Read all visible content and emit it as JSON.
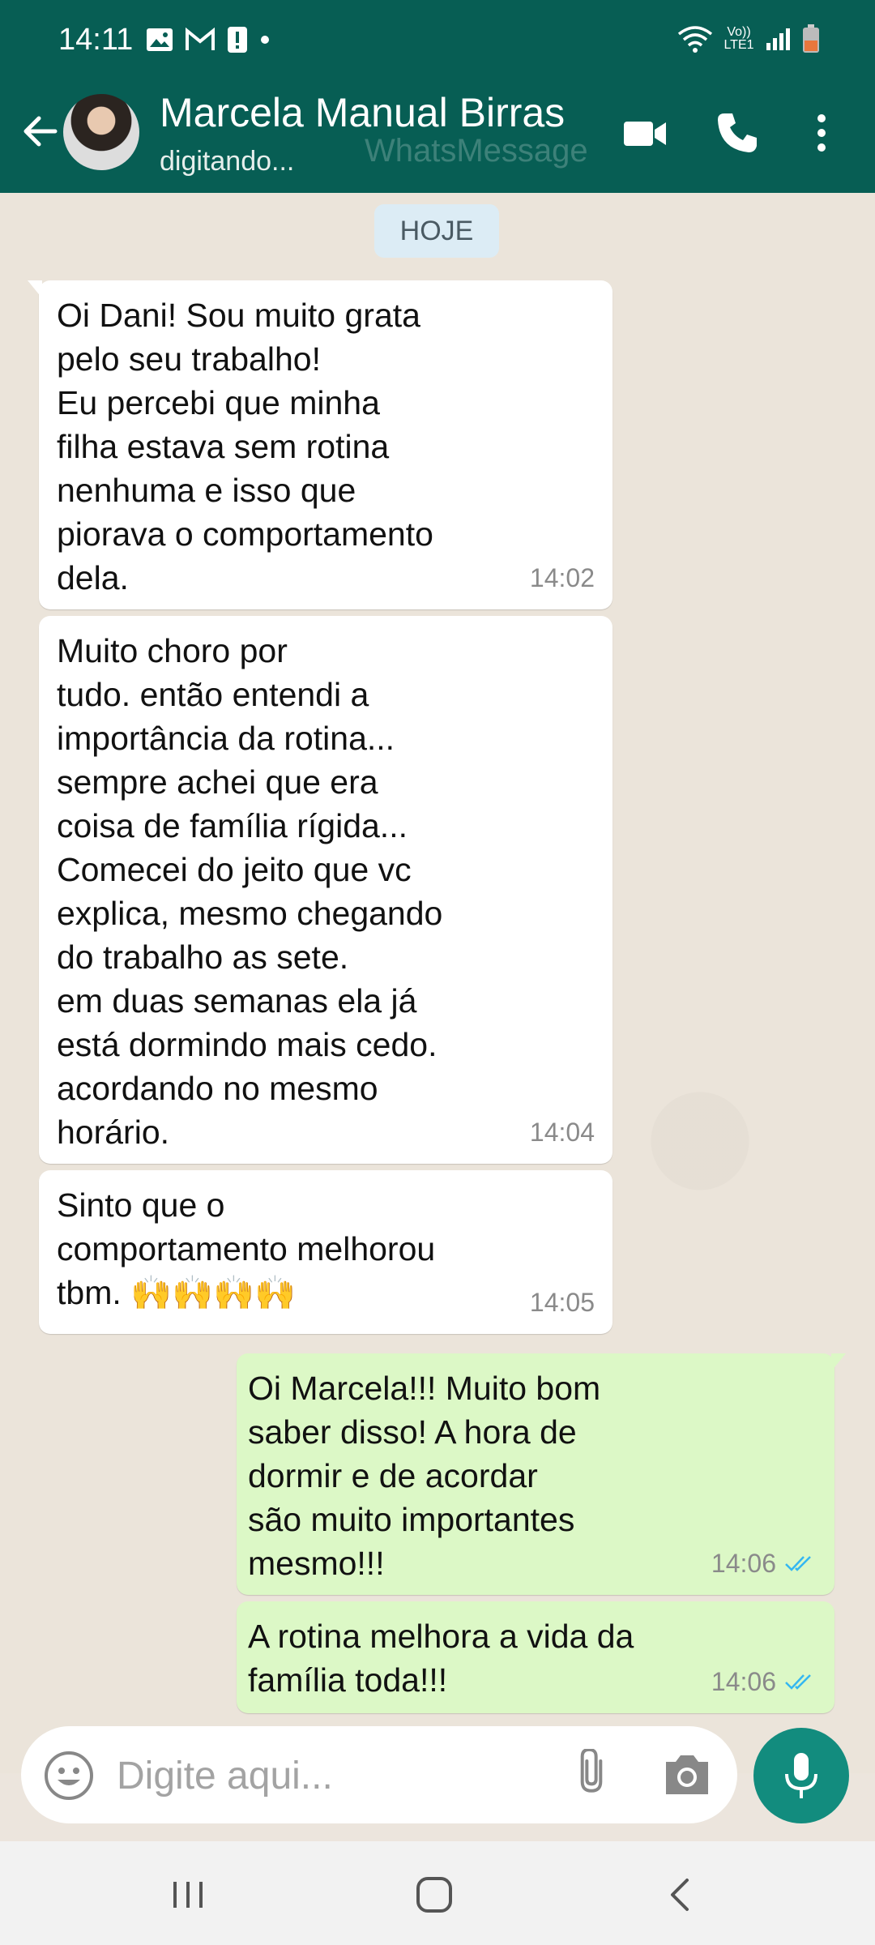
{
  "status_bar": {
    "time": "14:11",
    "left_icons": [
      "image-icon",
      "gmail-icon",
      "alert-icon",
      "dot-icon"
    ],
    "right_icons": [
      "wifi-icon",
      "volte-icon",
      "signal-icon",
      "battery-icon"
    ],
    "volte_label": "Vo)) LTE1"
  },
  "header": {
    "contact_name": "Marcela Manual Birras",
    "status": "digitando...",
    "watermark": "WhatsMessage",
    "icons": [
      "back-arrow-icon",
      "video-call-icon",
      "phone-icon",
      "more-vertical-icon"
    ]
  },
  "date_chip": "HOJE",
  "messages": [
    {
      "direction": "in",
      "text": "Oi Dani! Sou muito grata\npelo seu trabalho!\nEu percebi que minha\nfilha estava sem rotina\nnenhuma e isso que\npiorava o comportamento\ndela.",
      "time": "14:02"
    },
    {
      "direction": "in",
      "text": "Muito choro por\ntudo. então entendi a\nimportância da rotina...\nsempre achei que era\ncoisa de família rígida...\nComecei do jeito que vc\nexplica, mesmo chegando\ndo trabalho as sete.\nem duas semanas ela já\nestá dormindo mais cedo.\nacordando no mesmo\nhorário.",
      "time": "14:04"
    },
    {
      "direction": "in",
      "text": "Sinto que o\ncomportamento melhorou\ntbm. 🙌🙌🙌🙌",
      "time": "14:05"
    },
    {
      "direction": "out",
      "text": "Oi Marcela!!! Muito bom\nsaber disso! A hora de\ndormir e de  acordar\nsão muito importantes\nmesmo!!!",
      "time": "14:06",
      "read": true
    },
    {
      "direction": "out",
      "text": "A rotina melhora a vida da\nfamília toda!!!",
      "time": "14:06",
      "read": true
    }
  ],
  "input": {
    "placeholder": "Digite aqui...",
    "icons": [
      "emoji-icon",
      "attach-icon",
      "camera-icon",
      "mic-icon"
    ]
  },
  "colors": {
    "header": "#075e54",
    "incoming_bubble": "#ffffff",
    "outgoing_bubble": "#dcf8c6",
    "read_ticks": "#34b7f1",
    "mic_button": "#128c7e"
  },
  "nav": [
    "recents-icon",
    "home-icon",
    "back-icon"
  ]
}
